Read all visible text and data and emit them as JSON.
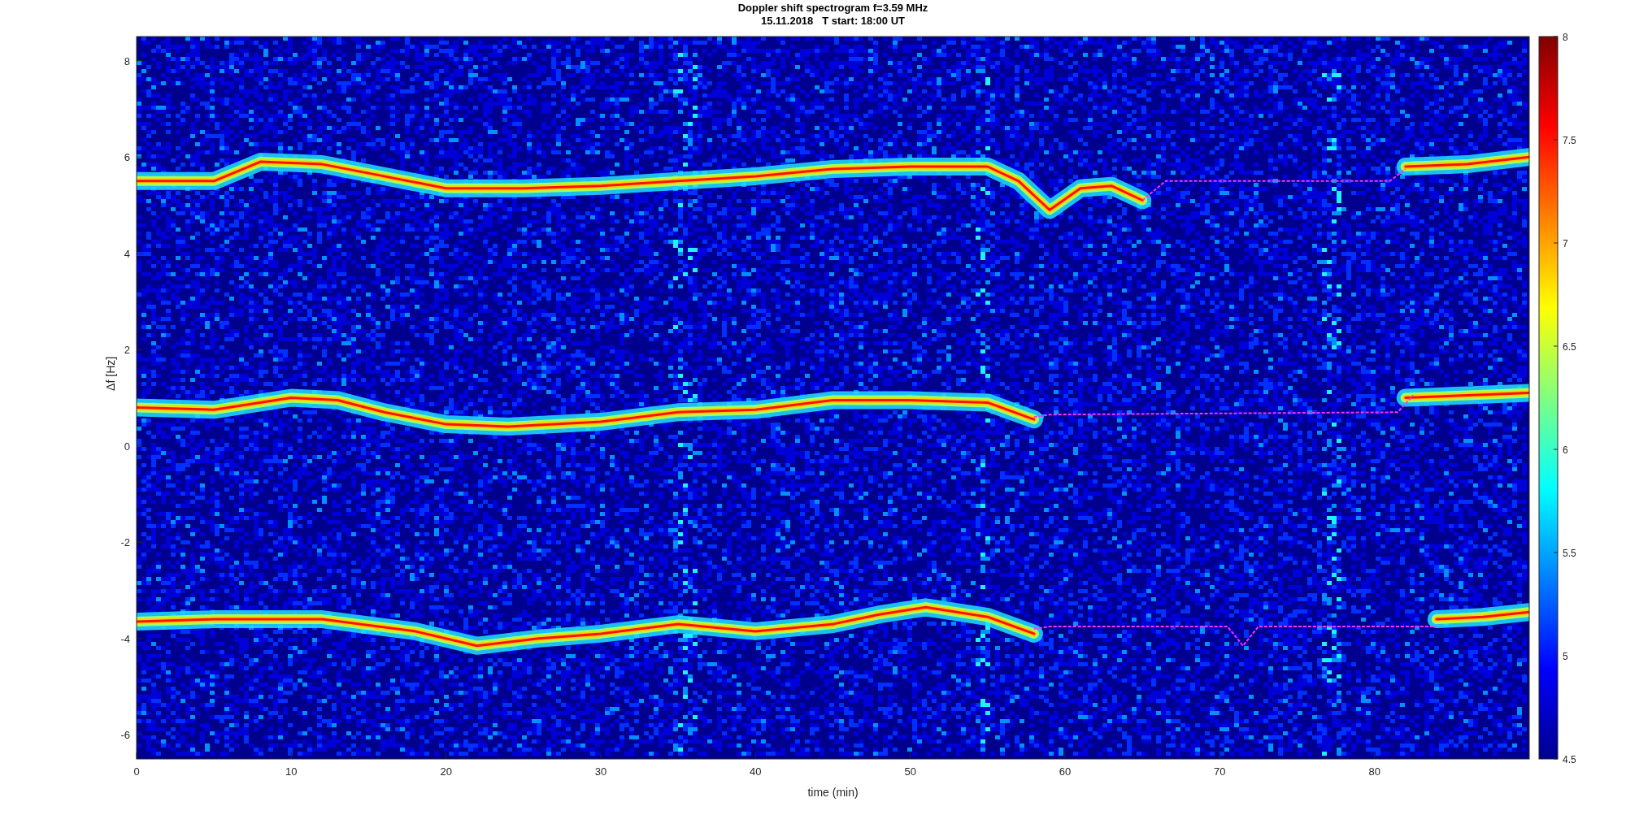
{
  "figure": {
    "title": "Doppler shift spectrogram f=3.59 MHz",
    "subtitle": "15.11.2018   T start: 18:00 UT"
  },
  "x_axis": {
    "label": "time (min)",
    "ticks": [
      "0",
      "10",
      "20",
      "30",
      "40",
      "50",
      "60",
      "70",
      "80"
    ]
  },
  "y_axis": {
    "label": "Δf [Hz]",
    "ticks": [
      "8",
      "6",
      "4",
      "2",
      "0",
      "-2",
      "-4",
      "-6"
    ]
  },
  "colorbar": {
    "ticks": [
      "8",
      "7.5",
      "7",
      "6.5",
      "6",
      "5.5",
      "5",
      "4.5"
    ]
  }
}
